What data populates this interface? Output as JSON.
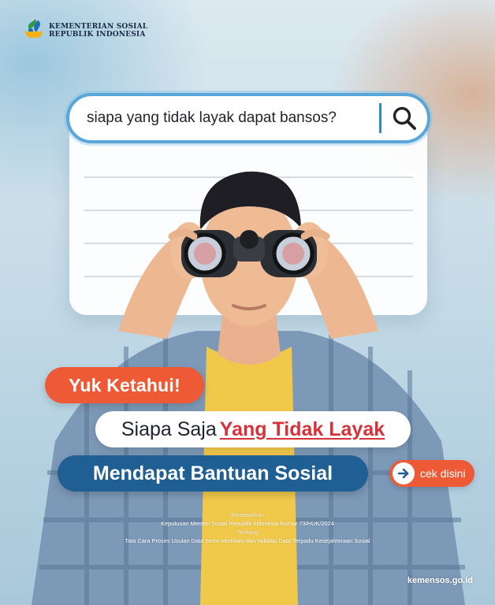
{
  "header": {
    "org_line1": "KEMENTERIAN SOSIAL",
    "org_line2": "REPUBLIK INDONESIA"
  },
  "search": {
    "query": "siapa yang tidak layak dapat bansos?",
    "icon": "search-icon"
  },
  "banners": {
    "kicker": "Yuk Ketahui!",
    "line1_prefix": "Siapa Saja",
    "line1_highlight": "Yang Tidak Layak",
    "line2": "Mendapat Bantuan Sosial",
    "cta_label": "cek disini",
    "cta_icon": "arrow-right-icon"
  },
  "footnote": {
    "l1": "Berdasarkan",
    "l2": "Keputusan Menteri Sosial Republik Indonesia Nomor 73/HUK/2024",
    "l3": "Tentang",
    "l4": "Tata Cara Proses Usulan Data Serta Verifikasi dan Validasi Data Terpadu Kesejahteraan Sosial"
  },
  "footer": {
    "website": "kemensos.go.id"
  },
  "colors": {
    "accent_orange": "#ee5a35",
    "accent_blue": "#1f5f93",
    "highlight_red": "#d9313a",
    "search_border": "#5aa6d8"
  }
}
